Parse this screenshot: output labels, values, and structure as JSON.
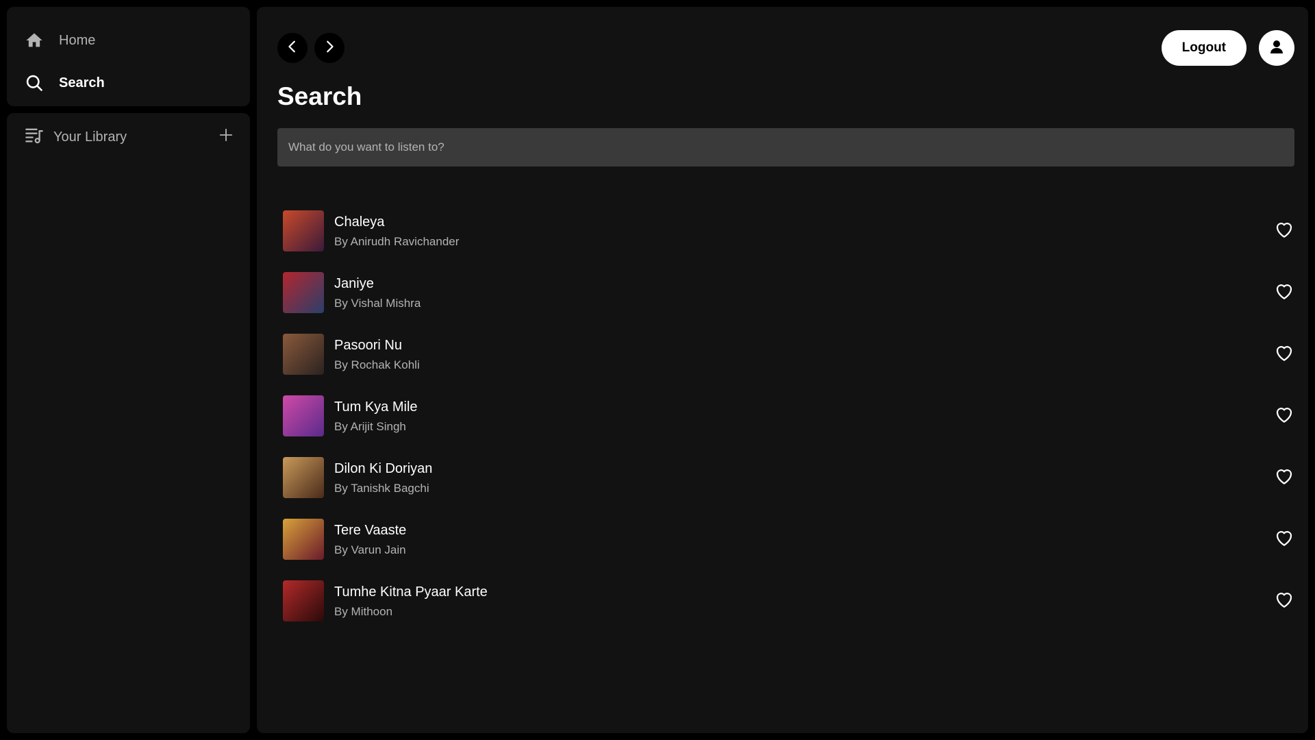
{
  "sidebar": {
    "nav": [
      {
        "label": "Home",
        "icon": "home-icon"
      },
      {
        "label": "Search",
        "icon": "search-icon"
      }
    ],
    "library": {
      "label": "Your Library",
      "icon": "library-icon",
      "add_icon": "plus-icon"
    }
  },
  "topbar": {
    "back_icon": "chevron-left-icon",
    "forward_icon": "chevron-right-icon",
    "logout_label": "Logout",
    "avatar_icon": "user-icon"
  },
  "main": {
    "title": "Search",
    "search_placeholder": "What do you want to listen to?",
    "search_value": ""
  },
  "songs": [
    {
      "title": "Chaleya",
      "artist": "By Anirudh Ravichander",
      "cover_colors": [
        "#c94a2a",
        "#3b1a3a"
      ]
    },
    {
      "title": "Janiye",
      "artist": "By Vishal Mishra",
      "cover_colors": [
        "#b3262e",
        "#2a3f6b"
      ]
    },
    {
      "title": "Pasoori Nu",
      "artist": "By Rochak Kohli",
      "cover_colors": [
        "#8a5a3c",
        "#2b2220"
      ]
    },
    {
      "title": "Tum Kya Mile",
      "artist": "By Arijit Singh",
      "cover_colors": [
        "#d04aa8",
        "#5a2a8a"
      ]
    },
    {
      "title": "Dilon Ki Doriyan",
      "artist": "By Tanishk Bagchi",
      "cover_colors": [
        "#c89a5a",
        "#4a2a1a"
      ]
    },
    {
      "title": "Tere Vaaste",
      "artist": "By Varun Jain",
      "cover_colors": [
        "#d8a23a",
        "#6a1a2a"
      ]
    },
    {
      "title": "Tumhe Kitna Pyaar Karte",
      "artist": "By Mithoon",
      "cover_colors": [
        "#b32a2a",
        "#2a0a0a"
      ]
    }
  ],
  "colors": {
    "background": "#000000",
    "panel": "#121212",
    "input": "#3a3a3a",
    "text_primary": "#ffffff",
    "text_secondary": "#b3b3b3"
  }
}
